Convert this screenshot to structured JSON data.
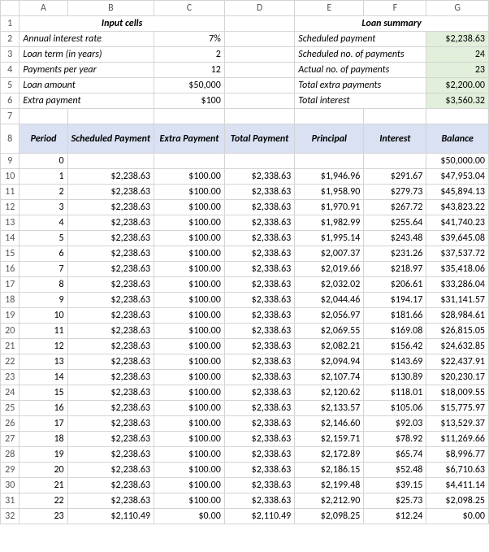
{
  "columns": [
    "A",
    "B",
    "C",
    "D",
    "E",
    "F",
    "G"
  ],
  "input_title": "Input cells",
  "summary_title": "Loan summary",
  "inputs": {
    "annual_interest_rate": {
      "label": "Annual interest rate",
      "value": "7%"
    },
    "loan_term_years": {
      "label": "Loan term (in years)",
      "value": "2"
    },
    "payments_per_year": {
      "label": "Payments per year",
      "value": "12"
    },
    "loan_amount": {
      "label": "Loan amount",
      "value": "$50,000"
    },
    "extra_payment": {
      "label": "Extra payment",
      "value": "$100"
    }
  },
  "summary": {
    "scheduled_payment": {
      "label": "Scheduled payment",
      "value": "$2,238.63"
    },
    "scheduled_no_payments": {
      "label": "Scheduled no. of payments",
      "value": "24"
    },
    "actual_no_payments": {
      "label": "Actual no. of payments",
      "value": "23"
    },
    "total_extra_payments": {
      "label": "Total extra payments",
      "value": "$2,200.00"
    },
    "total_interest": {
      "label": "Total interest",
      "value": "$3,560.32"
    }
  },
  "headers": {
    "period": "Period",
    "scheduled": "Scheduled Payment",
    "extra": "Extra Payment",
    "total": "Total Payment",
    "principal": "Principal",
    "interest": "Interest",
    "balance": "Balance"
  },
  "rows": [
    {
      "n": 9,
      "period": "0",
      "sched": "",
      "extra": "",
      "total": "",
      "principal": "",
      "interest": "",
      "balance": "$50,000.00"
    },
    {
      "n": 10,
      "period": "1",
      "sched": "$2,238.63",
      "extra": "$100.00",
      "total": "$2,338.63",
      "principal": "$1,946.96",
      "interest": "$291.67",
      "balance": "$47,953.04"
    },
    {
      "n": 11,
      "period": "2",
      "sched": "$2,238.63",
      "extra": "$100.00",
      "total": "$2,338.63",
      "principal": "$1,958.90",
      "interest": "$279.73",
      "balance": "$45,894.13"
    },
    {
      "n": 12,
      "period": "3",
      "sched": "$2,238.63",
      "extra": "$100.00",
      "total": "$2,338.63",
      "principal": "$1,970.91",
      "interest": "$267.72",
      "balance": "$43,823.22"
    },
    {
      "n": 13,
      "period": "4",
      "sched": "$2,238.63",
      "extra": "$100.00",
      "total": "$2,338.63",
      "principal": "$1,982.99",
      "interest": "$255.64",
      "balance": "$41,740.23"
    },
    {
      "n": 14,
      "period": "5",
      "sched": "$2,238.63",
      "extra": "$100.00",
      "total": "$2,338.63",
      "principal": "$1,995.14",
      "interest": "$243.48",
      "balance": "$39,645.08"
    },
    {
      "n": 15,
      "period": "6",
      "sched": "$2,238.63",
      "extra": "$100.00",
      "total": "$2,338.63",
      "principal": "$2,007.37",
      "interest": "$231.26",
      "balance": "$37,537.72"
    },
    {
      "n": 16,
      "period": "7",
      "sched": "$2,238.63",
      "extra": "$100.00",
      "total": "$2,338.63",
      "principal": "$2,019.66",
      "interest": "$218.97",
      "balance": "$35,418.06"
    },
    {
      "n": 17,
      "period": "8",
      "sched": "$2,238.63",
      "extra": "$100.00",
      "total": "$2,338.63",
      "principal": "$2,032.02",
      "interest": "$206.61",
      "balance": "$33,286.04"
    },
    {
      "n": 18,
      "period": "9",
      "sched": "$2,238.63",
      "extra": "$100.00",
      "total": "$2,338.63",
      "principal": "$2,044.46",
      "interest": "$194.17",
      "balance": "$31,141.57"
    },
    {
      "n": 19,
      "period": "10",
      "sched": "$2,238.63",
      "extra": "$100.00",
      "total": "$2,338.63",
      "principal": "$2,056.97",
      "interest": "$181.66",
      "balance": "$28,984.61"
    },
    {
      "n": 20,
      "period": "11",
      "sched": "$2,238.63",
      "extra": "$100.00",
      "total": "$2,338.63",
      "principal": "$2,069.55",
      "interest": "$169.08",
      "balance": "$26,815.05"
    },
    {
      "n": 21,
      "period": "12",
      "sched": "$2,238.63",
      "extra": "$100.00",
      "total": "$2,338.63",
      "principal": "$2,082.21",
      "interest": "$156.42",
      "balance": "$24,632.85"
    },
    {
      "n": 22,
      "period": "13",
      "sched": "$2,238.63",
      "extra": "$100.00",
      "total": "$2,338.63",
      "principal": "$2,094.94",
      "interest": "$143.69",
      "balance": "$22,437.91"
    },
    {
      "n": 23,
      "period": "14",
      "sched": "$2,238.63",
      "extra": "$100.00",
      "total": "$2,338.63",
      "principal": "$2,107.74",
      "interest": "$130.89",
      "balance": "$20,230.17"
    },
    {
      "n": 24,
      "period": "15",
      "sched": "$2,238.63",
      "extra": "$100.00",
      "total": "$2,338.63",
      "principal": "$2,120.62",
      "interest": "$118.01",
      "balance": "$18,009.55"
    },
    {
      "n": 25,
      "period": "16",
      "sched": "$2,238.63",
      "extra": "$100.00",
      "total": "$2,338.63",
      "principal": "$2,133.57",
      "interest": "$105.06",
      "balance": "$15,775.97"
    },
    {
      "n": 26,
      "period": "17",
      "sched": "$2,238.63",
      "extra": "$100.00",
      "total": "$2,338.63",
      "principal": "$2,146.60",
      "interest": "$92.03",
      "balance": "$13,529.37"
    },
    {
      "n": 27,
      "period": "18",
      "sched": "$2,238.63",
      "extra": "$100.00",
      "total": "$2,338.63",
      "principal": "$2,159.71",
      "interest": "$78.92",
      "balance": "$11,269.66"
    },
    {
      "n": 28,
      "period": "19",
      "sched": "$2,238.63",
      "extra": "$100.00",
      "total": "$2,338.63",
      "principal": "$2,172.89",
      "interest": "$65.74",
      "balance": "$8,996.77"
    },
    {
      "n": 29,
      "period": "20",
      "sched": "$2,238.63",
      "extra": "$100.00",
      "total": "$2,338.63",
      "principal": "$2,186.15",
      "interest": "$52.48",
      "balance": "$6,710.63"
    },
    {
      "n": 30,
      "period": "21",
      "sched": "$2,238.63",
      "extra": "$100.00",
      "total": "$2,338.63",
      "principal": "$2,199.48",
      "interest": "$39.15",
      "balance": "$4,411.14"
    },
    {
      "n": 31,
      "period": "22",
      "sched": "$2,238.63",
      "extra": "$100.00",
      "total": "$2,338.63",
      "principal": "$2,212.90",
      "interest": "$25.73",
      "balance": "$2,098.25"
    },
    {
      "n": 32,
      "period": "23",
      "sched": "$2,110.49",
      "extra": "$0.00",
      "total": "$2,110.49",
      "principal": "$2,098.25",
      "interest": "$12.24",
      "balance": "$0.00"
    }
  ]
}
